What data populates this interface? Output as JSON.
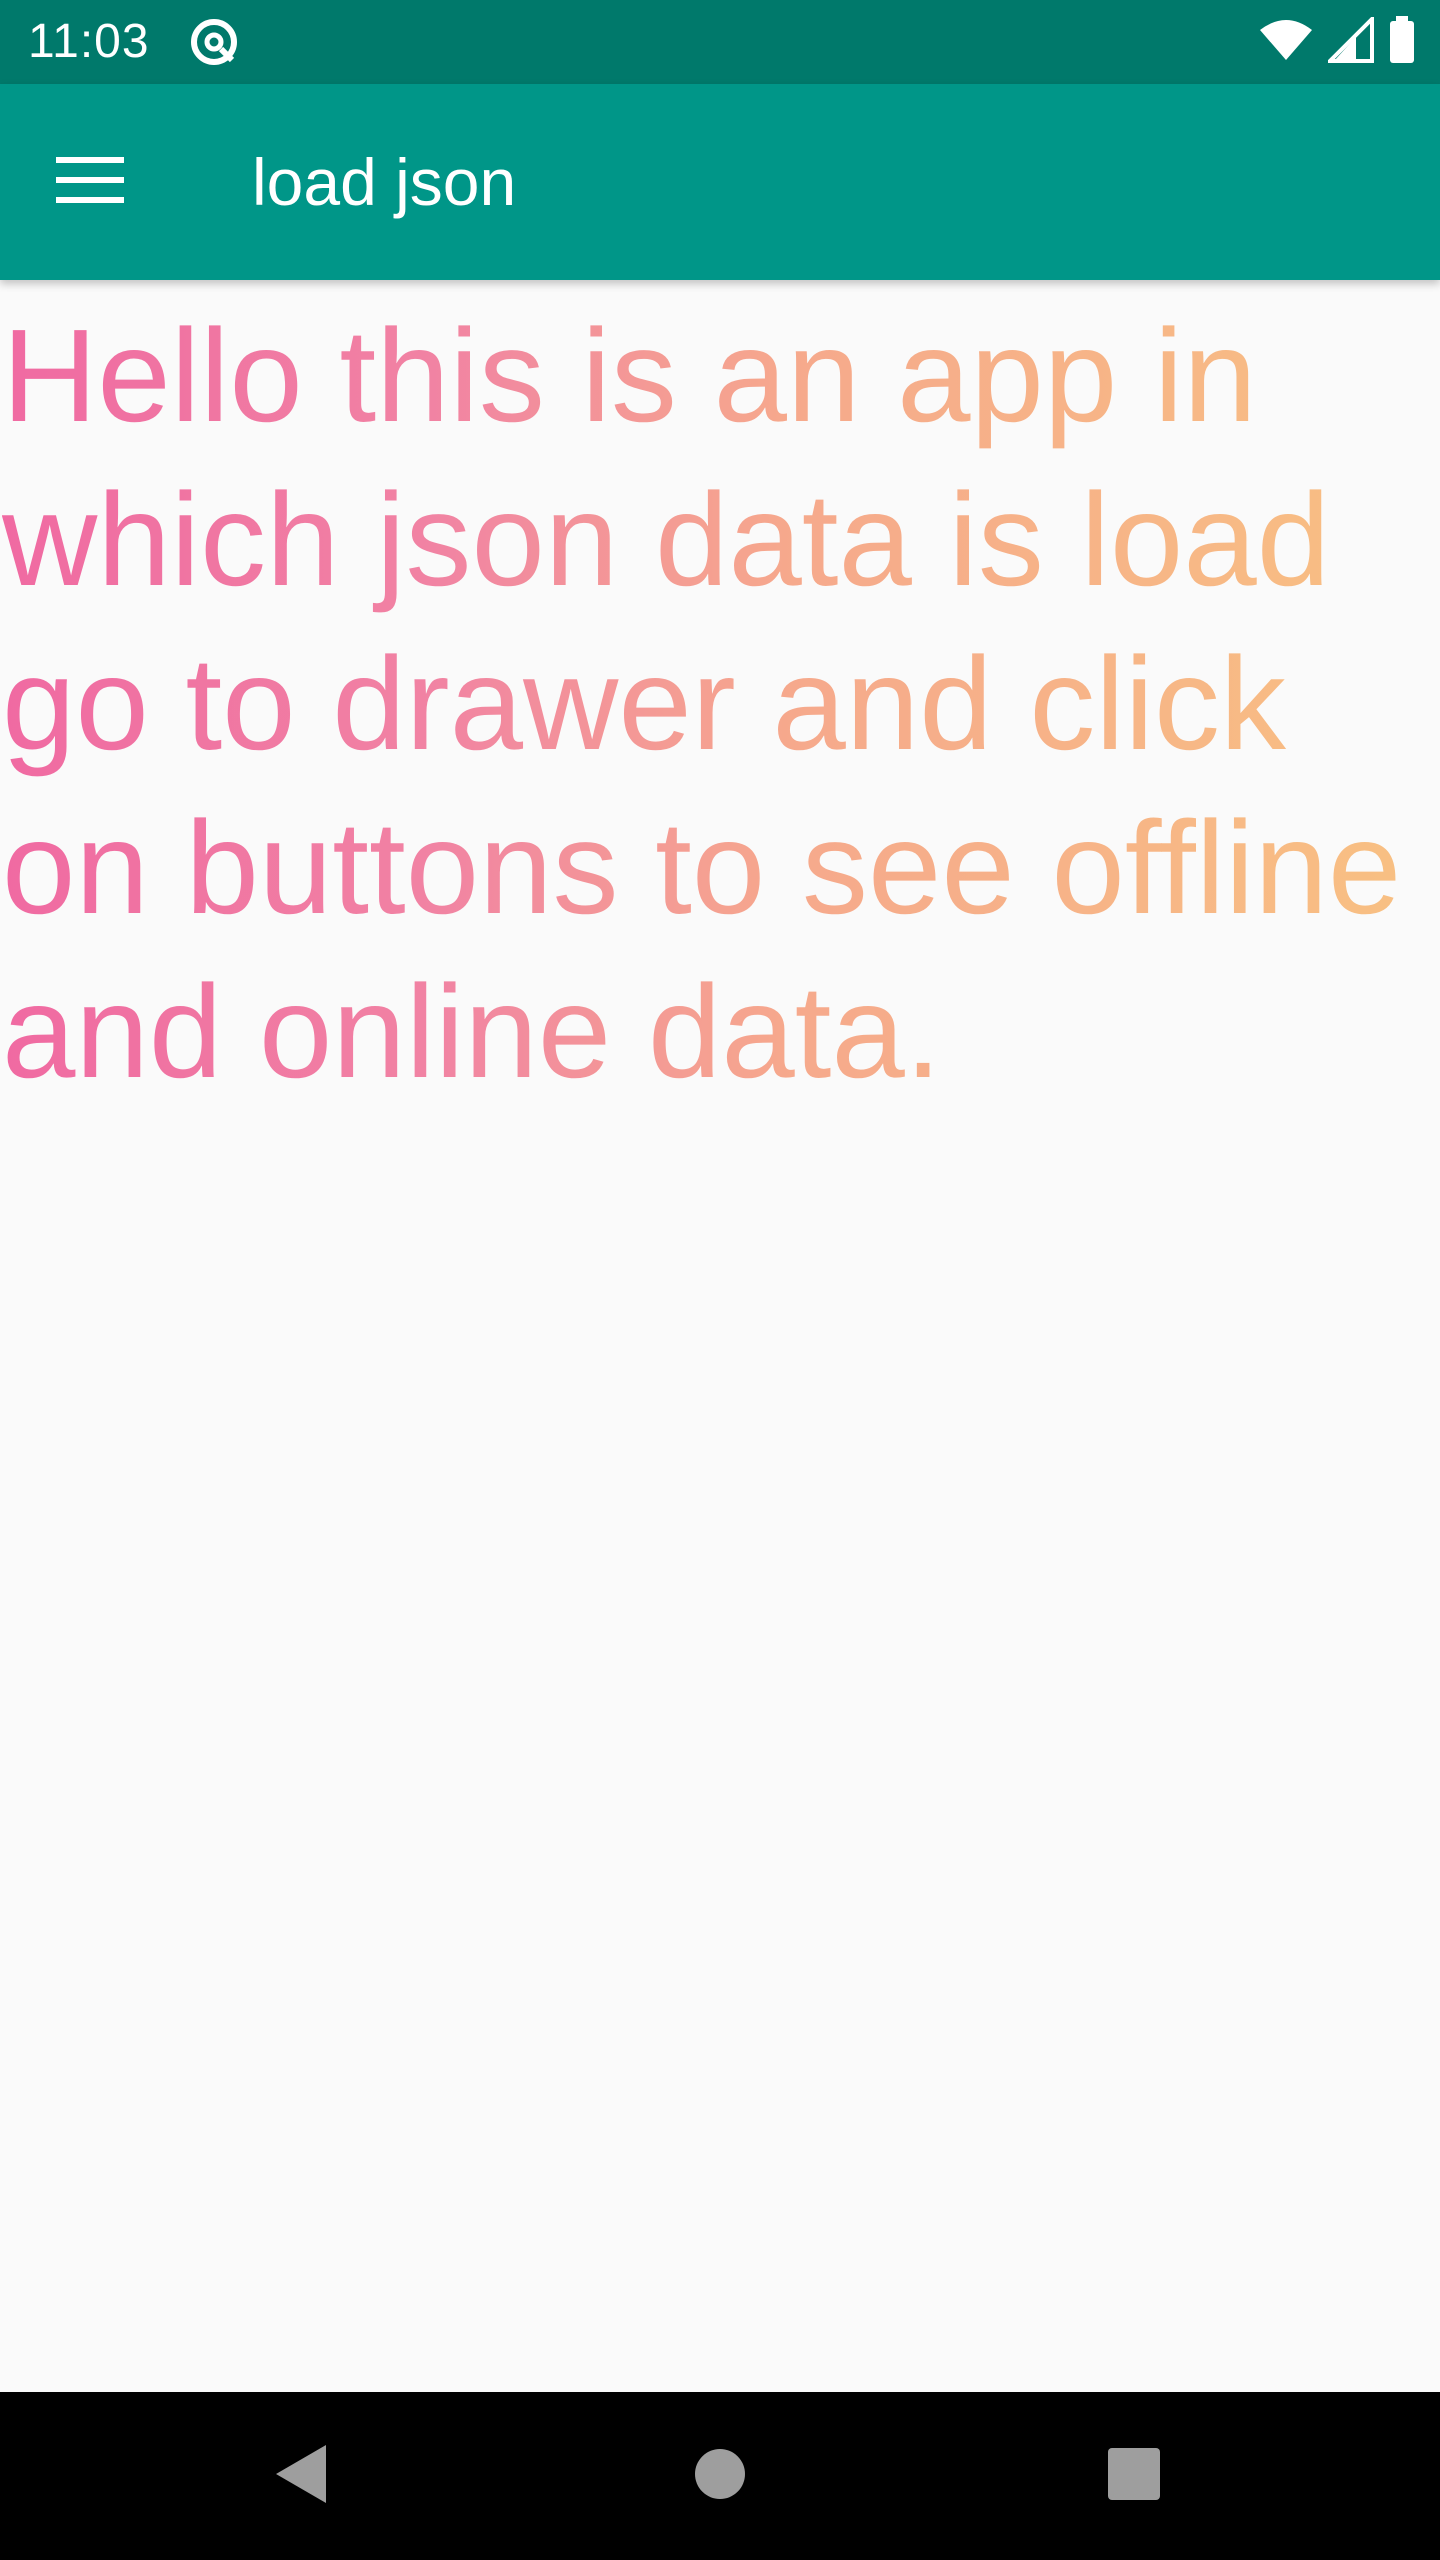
{
  "status_bar": {
    "time": "11:03",
    "background": "#00796b",
    "icons": [
      "notification-at-icon",
      "wifi-icon",
      "signal-icon",
      "battery-icon"
    ]
  },
  "app_bar": {
    "title": "load json",
    "background": "#009688",
    "menu_icon": "hamburger-menu-icon"
  },
  "content": {
    "intro_text": "Hello this is an app in which json data is load go to drawer and click on buttons to see offline and online data.",
    "gradient_colors": [
      "#f06aa2",
      "#f8c182"
    ]
  },
  "nav_bar": {
    "icons": [
      "back-icon",
      "home-icon",
      "recents-icon"
    ],
    "background": "#000000"
  }
}
